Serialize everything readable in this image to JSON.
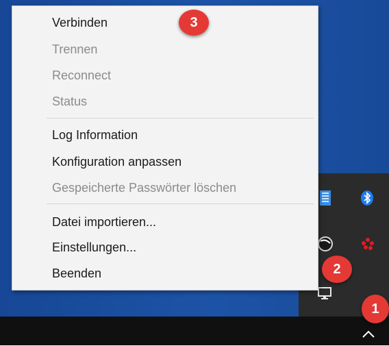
{
  "context_menu": {
    "items": [
      {
        "label": "Verbinden",
        "enabled": true
      },
      {
        "label": "Trennen",
        "enabled": false
      },
      {
        "label": "Reconnect",
        "enabled": false
      },
      {
        "label": "Status",
        "enabled": false
      },
      {
        "label": "Log Information",
        "enabled": true
      },
      {
        "label": "Konfiguration anpassen",
        "enabled": true
      },
      {
        "label": "Gespeicherte Passwörter löschen",
        "enabled": false
      },
      {
        "label": "Datei importieren...",
        "enabled": true
      },
      {
        "label": "Einstellungen...",
        "enabled": true
      },
      {
        "label": "Beenden",
        "enabled": true
      }
    ]
  },
  "annotations": {
    "badge_1": "1",
    "badge_2": "2",
    "badge_3": "3"
  },
  "tray_icons": [
    "grid-icon",
    "bluetooth-icon",
    "round-icon",
    "red-dots-icon",
    "monitor-icon"
  ],
  "taskbar": {
    "overflow_icon": "chevron-up-icon"
  },
  "colors": {
    "desktop": "#1e4f9c",
    "taskbar": "#101010",
    "tray_panel": "#2b2b2b",
    "menu_bg": "#f3f3f3",
    "menu_text": "#1a1a1a",
    "menu_disabled": "#8b8b8b",
    "badge": "#e53935"
  }
}
